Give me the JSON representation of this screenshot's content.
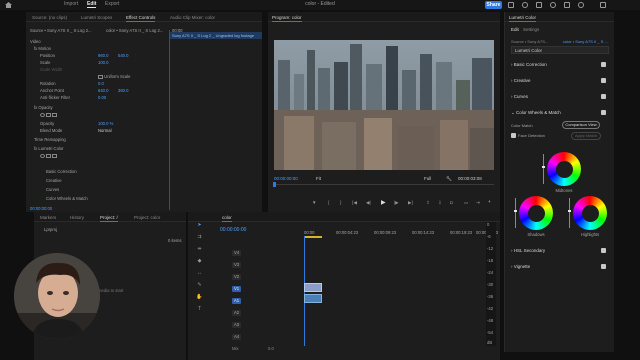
{
  "topbar": {
    "import_label": "Import",
    "edit_label": "Edit",
    "export_label": "Export",
    "title": "color - Edited",
    "share_label": "Share"
  },
  "effect_controls": {
    "tabs": [
      "Source: (no clips)",
      "Lumetri Scopes",
      "Effect Controls",
      "Audio Clip Mixer: color"
    ],
    "active_tab": "Effect Controls",
    "clip_selector": "Source • Sony A7S II _ S Log 2...",
    "sequence_selector": "color • Sony A7S II _ S Log 2...",
    "timecode": "00;00",
    "clip_label": "Sony A7S II _ S Log 2 _ Ungraded log footage",
    "video_header": "Video",
    "motion_label": "Motion",
    "position_label": "Position",
    "position_x": "960.0",
    "position_y": "540.0",
    "scale_label": "Scale",
    "scale_value": "100.0",
    "scale_width_label": "Scale Width",
    "uniform_scale_label": "Uniform Scale",
    "rotation_label": "Rotation",
    "rotation_value": "0.0",
    "anchor_label": "Anchor Point",
    "anchor_x": "640.0",
    "anchor_y": "360.0",
    "antiflicker_label": "Anti-flicker Filter",
    "antiflicker_value": "0.00",
    "opacity_header": "Opacity",
    "opacity_label": "Opacity",
    "opacity_value": "100.0 %",
    "blend_label": "Blend Mode",
    "blend_value": "Normal",
    "time_remap_label": "Time Remapping",
    "lumetri_header": "Lumetri Color",
    "basic_label": "Basic Correction",
    "creative_label": "Creative",
    "curves_label": "Curves",
    "wheels_label": "Color Wheels & Match",
    "footer_timecode": "00:00:00:00"
  },
  "program_monitor": {
    "title": "Program: color",
    "timecode": "00:00:00:00",
    "fit_label": "Fit",
    "quality_label": "Full",
    "duration": "00:00:03:08"
  },
  "lumetri": {
    "panel_title": "Lumetri Color",
    "tab_edit": "Edit",
    "tab_settings": "Settings",
    "source_selector": "Source • Sony A7S...",
    "sequence_selector": "color • Sony A7S II _ S ...",
    "effect_selector": "Lumetri Color",
    "sections": [
      "Basic Correction",
      "Creative",
      "Curves",
      "Color Wheels & Match"
    ],
    "color_match_label": "Color Match",
    "comparison_label": "Comparison View",
    "face_detection_label": "Face Detection",
    "apply_match_label": "Apply Match",
    "midtones_label": "Midtones",
    "shadows_label": "Shadows",
    "highlights_label": "Highlights",
    "hsl_label": "HSL Secondary",
    "vignette_label": "Vignette"
  },
  "project": {
    "tabs": [
      "Markers",
      "History",
      "Project: /",
      "Project: color"
    ],
    "active_tab": "Project: /",
    "path": "Lprproj",
    "items_count": "0 items",
    "import_hint": "media to start"
  },
  "timeline": {
    "title": "color",
    "timecode": "00:00:00:00",
    "ruler": [
      "00:00",
      "00:00:04:23",
      "00:00:09:23",
      "00:00:14:23",
      "00:00:19:23",
      "00:00:24:23"
    ],
    "video_tracks": [
      "V4",
      "V3",
      "V2",
      "V1"
    ],
    "audio_tracks": [
      "A1",
      "A2",
      "A3",
      "A4"
    ],
    "mix_label": "Mix",
    "mix_value": "0.0"
  },
  "meters": {
    "scale": [
      "0",
      "-6",
      "-12",
      "-18",
      "-24",
      "-30",
      "-36",
      "-42",
      "-48",
      "-54",
      "dB"
    ]
  }
}
